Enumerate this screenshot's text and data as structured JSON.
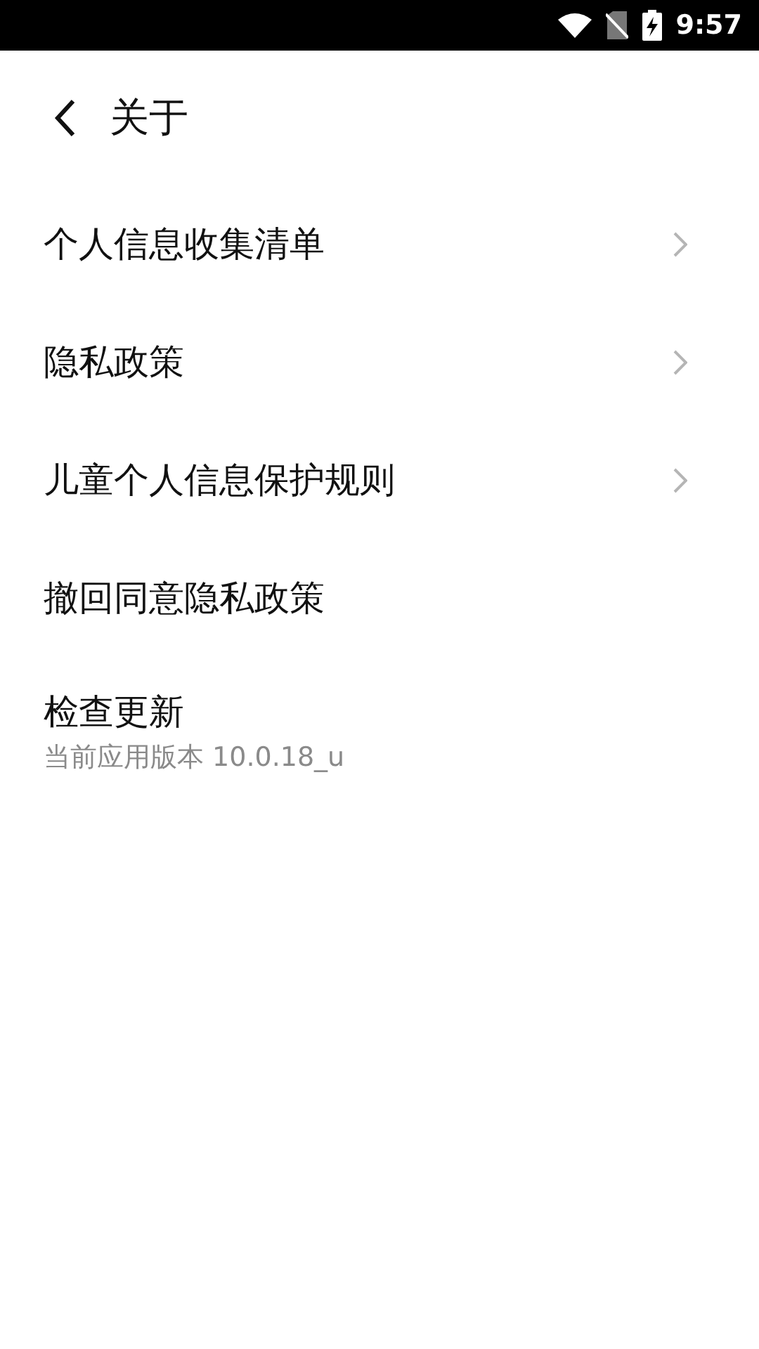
{
  "status_bar": {
    "time": "9:57"
  },
  "header": {
    "title": "关于"
  },
  "items": [
    {
      "kind": "link",
      "label": "个人信息收集清单"
    },
    {
      "kind": "link",
      "label": "隐私政策"
    },
    {
      "kind": "link",
      "label": "儿童个人信息保护规则"
    },
    {
      "kind": "action",
      "label": "撤回同意隐私政策"
    },
    {
      "kind": "info",
      "label": "检查更新",
      "subtitle": "当前应用版本 10.0.18_u"
    }
  ]
}
